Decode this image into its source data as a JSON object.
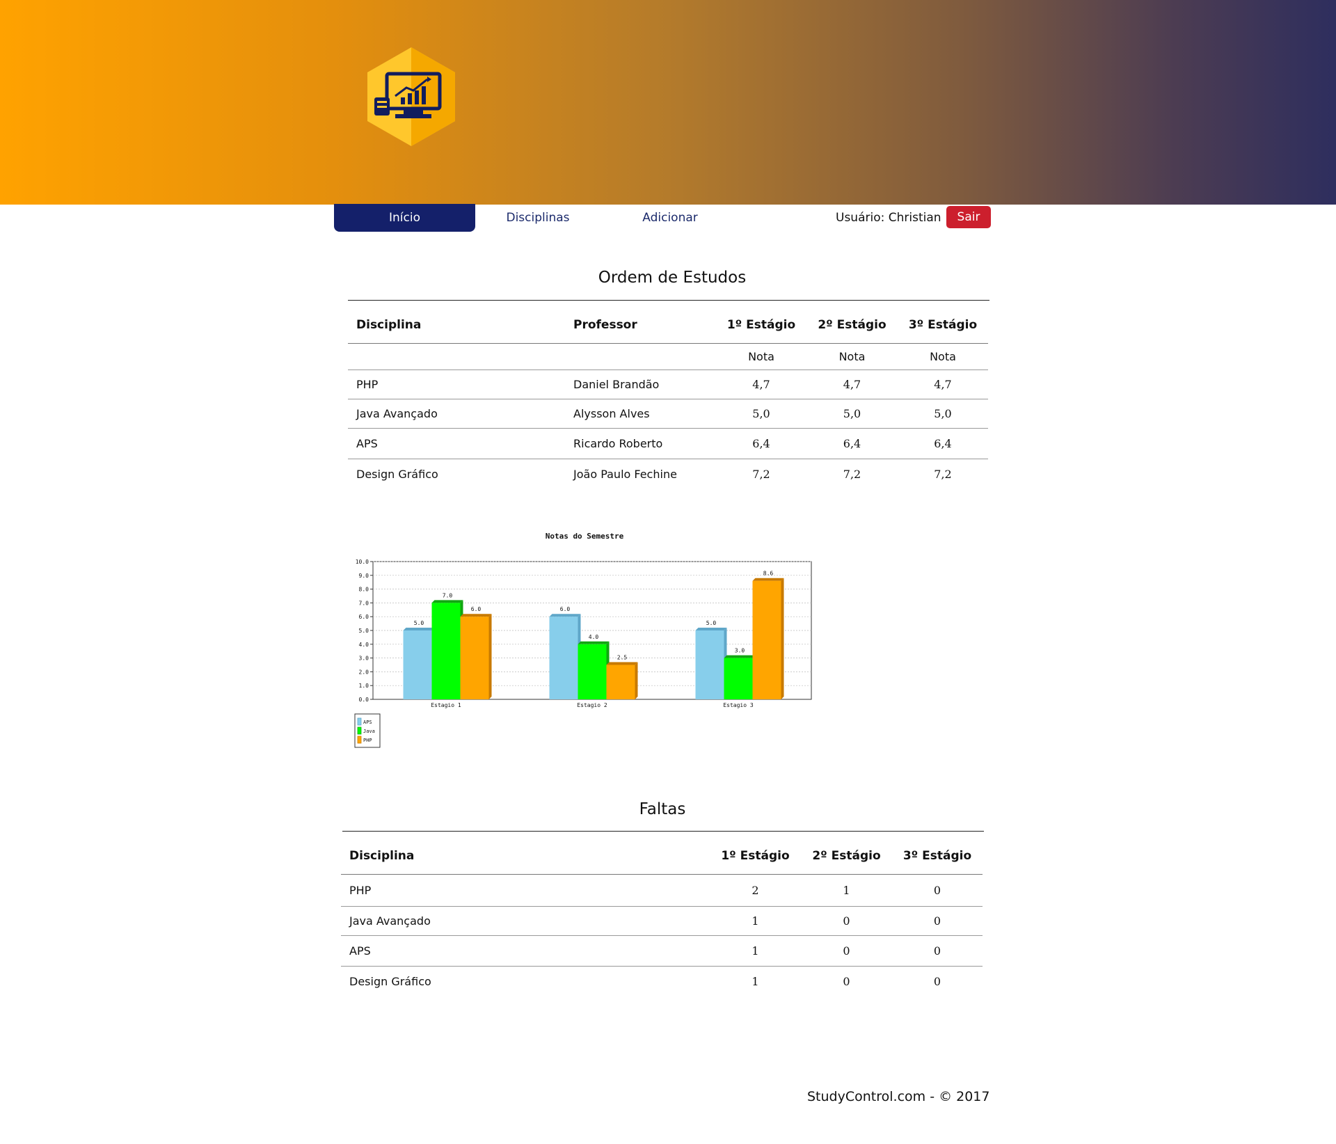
{
  "nav": {
    "items": [
      "Início",
      "Disciplinas",
      "Adicionar"
    ],
    "active_index": 0,
    "user_label": "Usuário: Christian",
    "logout_label": "Sair"
  },
  "study_order": {
    "title": "Ordem de Estudos",
    "headers": [
      "Disciplina",
      "Professor",
      "1º Estágio",
      "2º Estágio",
      "3º Estágio"
    ],
    "subheaders": [
      "Nota",
      "Nota",
      "Nota"
    ],
    "rows": [
      {
        "disciplina": "PHP",
        "professor": "Daniel Brandão",
        "notas": [
          "4,7",
          "4,7",
          "4,7"
        ]
      },
      {
        "disciplina": "Java Avançado",
        "professor": "Alysson Alves",
        "notas": [
          "5,0",
          "5,0",
          "5,0"
        ]
      },
      {
        "disciplina": "APS",
        "professor": "Ricardo Roberto",
        "notas": [
          "6,4",
          "6,4",
          "6,4"
        ]
      },
      {
        "disciplina": "Design Gráfico",
        "professor": "João Paulo Fechine",
        "notas": [
          "7,2",
          "7,2",
          "7,2"
        ]
      }
    ]
  },
  "chart_data": {
    "type": "bar",
    "title": "Notas do Semestre",
    "xlabel": "",
    "ylabel": "",
    "categories": [
      "Estagio 1",
      "Estagio 2",
      "Estagio 3"
    ],
    "series": [
      {
        "name": "APS",
        "values": [
          5.0,
          6.0,
          5.0
        ],
        "color": "#87ceeb",
        "edge": "#5fa7c9"
      },
      {
        "name": "Java",
        "values": [
          7.0,
          4.0,
          3.0
        ],
        "color": "#00ff00",
        "edge": "#11a611"
      },
      {
        "name": "PHP",
        "values": [
          6.0,
          2.5,
          8.6
        ],
        "color": "#ffa500",
        "edge": "#c87a00"
      }
    ],
    "ylim": [
      0,
      10
    ],
    "yticks": [
      "0.0",
      "1.0",
      "2.0",
      "3.0",
      "4.0",
      "5.0",
      "6.0",
      "7.0",
      "8.0",
      "9.0",
      "10.0"
    ],
    "value_labels": [
      [
        "5.0",
        "6.0",
        "5.0"
      ],
      [
        "7.0",
        "4.0",
        "3.0"
      ],
      [
        "6.0",
        "2.5",
        "8.6"
      ]
    ],
    "grid": true,
    "legend_position": "bottom-left"
  },
  "absences": {
    "title": "Faltas",
    "headers": [
      "Disciplina",
      "1º Estágio",
      "2º Estágio",
      "3º Estágio"
    ],
    "rows": [
      {
        "disciplina": "PHP",
        "faltas": [
          "2",
          "1",
          "0"
        ]
      },
      {
        "disciplina": "Java Avançado",
        "faltas": [
          "1",
          "0",
          "0"
        ]
      },
      {
        "disciplina": "APS",
        "faltas": [
          "1",
          "0",
          "0"
        ]
      },
      {
        "disciplina": "Design Gráfico",
        "faltas": [
          "1",
          "0",
          "0"
        ]
      }
    ]
  },
  "footer": {
    "text": "StudyControl.com - © 2017"
  },
  "colors": {
    "accent": "#ffa200",
    "nav_active": "#14206a",
    "logout": "#cc1f2d"
  }
}
